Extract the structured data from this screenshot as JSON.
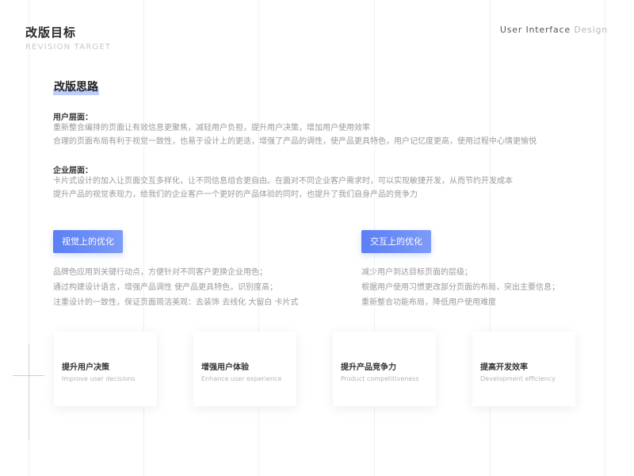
{
  "header": {
    "title": "改版目标",
    "subtitle": "REVISION TARGET",
    "right_main": "User Interface",
    "right_accent": "Design"
  },
  "section_title": "改版思路",
  "user_level": {
    "title": "用户层面：",
    "lines": [
      "重新整合编排的页面让有效信息更聚焦，减轻用户负担，提升用户决策，增加用户使用效率",
      "合理的页面布局有利于视觉一致性，也易于设计上的更迭，增强了产品的调性，使产品更具特色，用户记忆度更高，使用过程中心情更愉悦"
    ]
  },
  "enterprise_level": {
    "title": "企业层面：",
    "lines": [
      "卡片式设计的加入让页面交互多样化，让不同信息组合更自由。在面对不同企业客户需求时，可以实现敏捷开发，从而节约开发成本",
      "提升产品的视觉表现力，给我们的企业客户一个更好的产品体验的同时，也提升了我们自身产品的竞争力"
    ]
  },
  "visual": {
    "label": "视觉上的优化",
    "lines": [
      "品牌色应用到关键行动点，方便针对不同客户更换企业用色；",
      "通过构建设计语言，增强产品调性   使产品更具特色，识别度高；",
      "注重设计的一致性，保证页面简洁美观：去装饰 去线化 大留白 卡片式"
    ]
  },
  "interaction": {
    "label": "交互上的优化",
    "lines": [
      "减少用户到达目标页面的层级；",
      "根据用户使用习惯更改部分页面的布局，突出主要信息；",
      "重新整合功能布局，降低用户使用难度"
    ]
  },
  "cards": [
    {
      "title": "提升用户决策",
      "subtitle": "Improve user decisions"
    },
    {
      "title": "增强用户体验",
      "subtitle": "Enhance user experience"
    },
    {
      "title": "提升产品竞争力",
      "subtitle": "Product competitiveness"
    },
    {
      "title": "提高开发效率",
      "subtitle": "Development efficiency"
    }
  ]
}
